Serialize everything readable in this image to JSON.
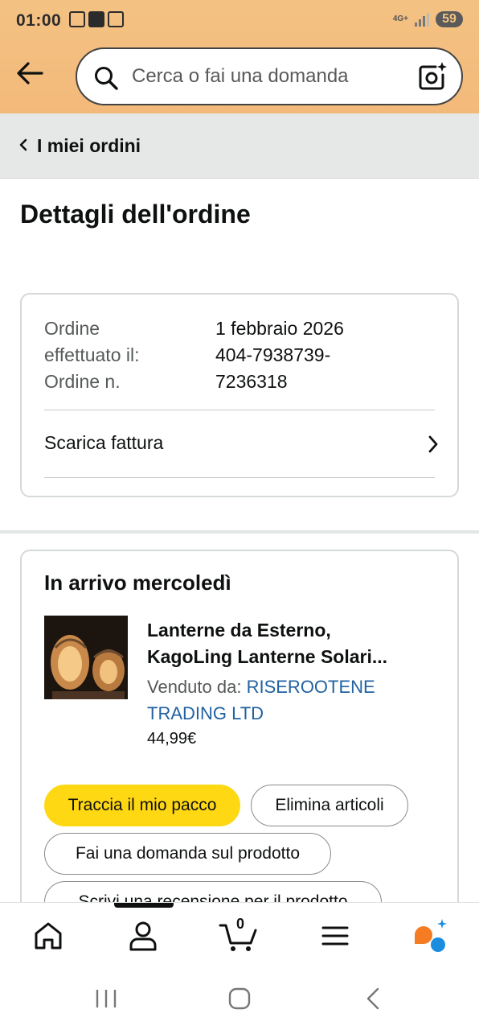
{
  "status_bar": {
    "time": "01:00",
    "network": "4G+",
    "battery": "59"
  },
  "header": {
    "search_placeholder": "Cerca o fai una domanda",
    "background_color": "#f3be7f"
  },
  "breadcrumb": {
    "label": "I miei ordini"
  },
  "page_title": "Dettagli dell'ordine",
  "order_summary": {
    "labels": [
      "Ordine",
      "effettuato il:",
      "Ordine n."
    ],
    "date": "1 febbraio 2026",
    "order_number": "404-7938739-7236318",
    "invoice_label": "Scarica fattura"
  },
  "shipment": {
    "heading": "In arrivo mercoledì",
    "product": {
      "title_line1": "Lanterne da Esterno,",
      "title_line2": "KagoLing Lanterne Solari...",
      "sold_by_label": "Venduto da:",
      "seller": "RISEROOTENE TRADING LTD",
      "price": "44,99€"
    },
    "actions": {
      "track": "Traccia il mio pacco",
      "delete": "Elimina articoli",
      "ask": "Fai una domanda sul prodotto",
      "review": "Scrivi una recensione per il prodotto"
    }
  },
  "bottom_nav": {
    "cart_count": "0",
    "items": [
      "home-icon",
      "account-icon",
      "cart-icon",
      "menu-icon",
      "rufus-icon"
    ]
  },
  "colors": {
    "accent_button": "#ffd814",
    "link": "#2162a1",
    "rufus_orange": "#f57c22",
    "rufus_blue": "#1a8ddf"
  }
}
